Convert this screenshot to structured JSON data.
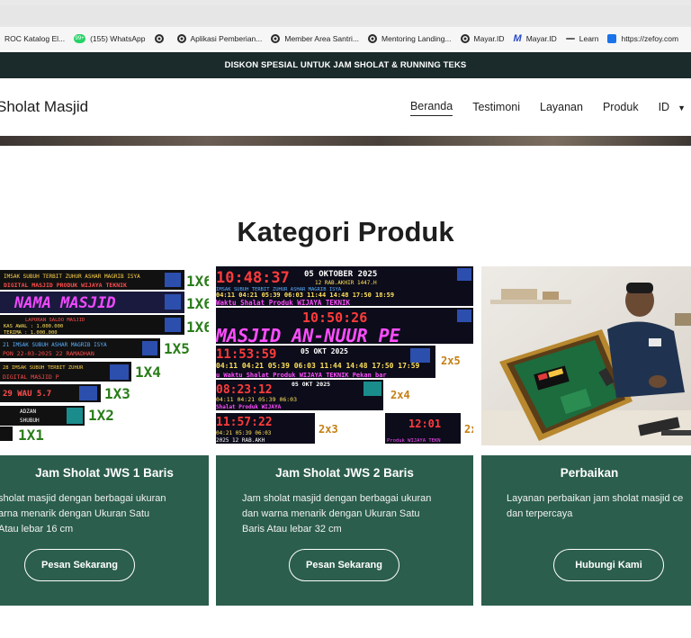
{
  "bookmarks": [
    {
      "label": "ROC Katalog El...",
      "icon": "globe-icon"
    },
    {
      "label": "(155) WhatsApp",
      "icon": "whatsapp-icon"
    },
    {
      "label": "",
      "icon": "globe-icon"
    },
    {
      "label": "Aplikasi Pemberian...",
      "icon": "globe-icon"
    },
    {
      "label": "Member Area Santri...",
      "icon": "globe-icon"
    },
    {
      "label": "Mentoring Landing...",
      "icon": "globe-icon"
    },
    {
      "label": "Mayar.ID",
      "icon": "globe-icon"
    },
    {
      "label": "Mayar.ID",
      "icon": "mayar-icon"
    },
    {
      "label": "Learn",
      "icon": "learn-icon"
    },
    {
      "label": "https://zefoy.com",
      "icon": "thumbs-up-icon"
    }
  ],
  "announcement": "DISKON SPESIAL UNTUK JAM SHOLAT & RUNNING TEKS",
  "header": {
    "brand": "Sholat Masjid",
    "nav": [
      "Beranda",
      "Testimoni",
      "Layanan",
      "Produk"
    ],
    "lang": "ID"
  },
  "section_title": "Kategori Produk",
  "cards": [
    {
      "title": "Jam Sholat JWS 1 Baris",
      "desc": [
        "sholat masjid dengan berbagai ukuran",
        "arna menarik dengan Ukuran Satu",
        "Atau lebar 16 cm"
      ],
      "button": "Pesan Sekarang",
      "image": {
        "labels": [
          "IMSAK SUBUH TERBIT ZUHUR ASHAR MAGRIB ISYA",
          "DIGITAL MASJID PRODUK WIJAYA TEKNIK",
          "NAMA MASJID",
          "LAPORAN SALDO MASJID",
          "KAS AWAL : 1.000.000",
          "TERIMA : 1.000.000",
          "PON 22-03-2025 22 RAMADHAN",
          "DIGITAL MASJID P",
          "ADZAN SHUBUH"
        ],
        "sizes": [
          "1X6",
          "1X6",
          "1X6",
          "1X5",
          "1X4",
          "1X3",
          "1X2",
          "1X1"
        ]
      }
    },
    {
      "title": "Jam Sholat JWS 2 Baris",
      "desc": [
        "Jam sholat masjid dengan berbagai ukuran",
        "dan warna menarik dengan Ukuran Satu",
        "Baris Atau lebar 32 cm"
      ],
      "button": "Pesan Sekarang",
      "image": {
        "clocks": [
          "10:48:37",
          "10:50:26",
          "11:53:59",
          "08:23:12",
          "11:57:22",
          "12:01"
        ],
        "dates": [
          "05 OKTOBER 2025",
          "05 OKT 2025",
          "05 OKT 2025"
        ],
        "hijri": "12 RAB.AKHIR 1447.H",
        "prayer_names": "IMSAK SUBUH TERBIT ZUHUR ASHAR MAGRIB ISYA",
        "prayer_times": "04:11 04:21 05:39 06:03 11:44 14:48 17:50 18:59",
        "scroll_text": "Waktu Shalat Produk WIJAYA TEKNIK",
        "masjid": "MASJID AN-NUUR PE",
        "sizes": [
          "2x5",
          "2x4",
          "2x3",
          "2x"
        ]
      }
    },
    {
      "title": "Perbaikan",
      "desc": [
        "Layanan perbaikan jam sholat masjid ce",
        "dan terpercaya"
      ],
      "button": "Hubungi Kami"
    }
  ]
}
